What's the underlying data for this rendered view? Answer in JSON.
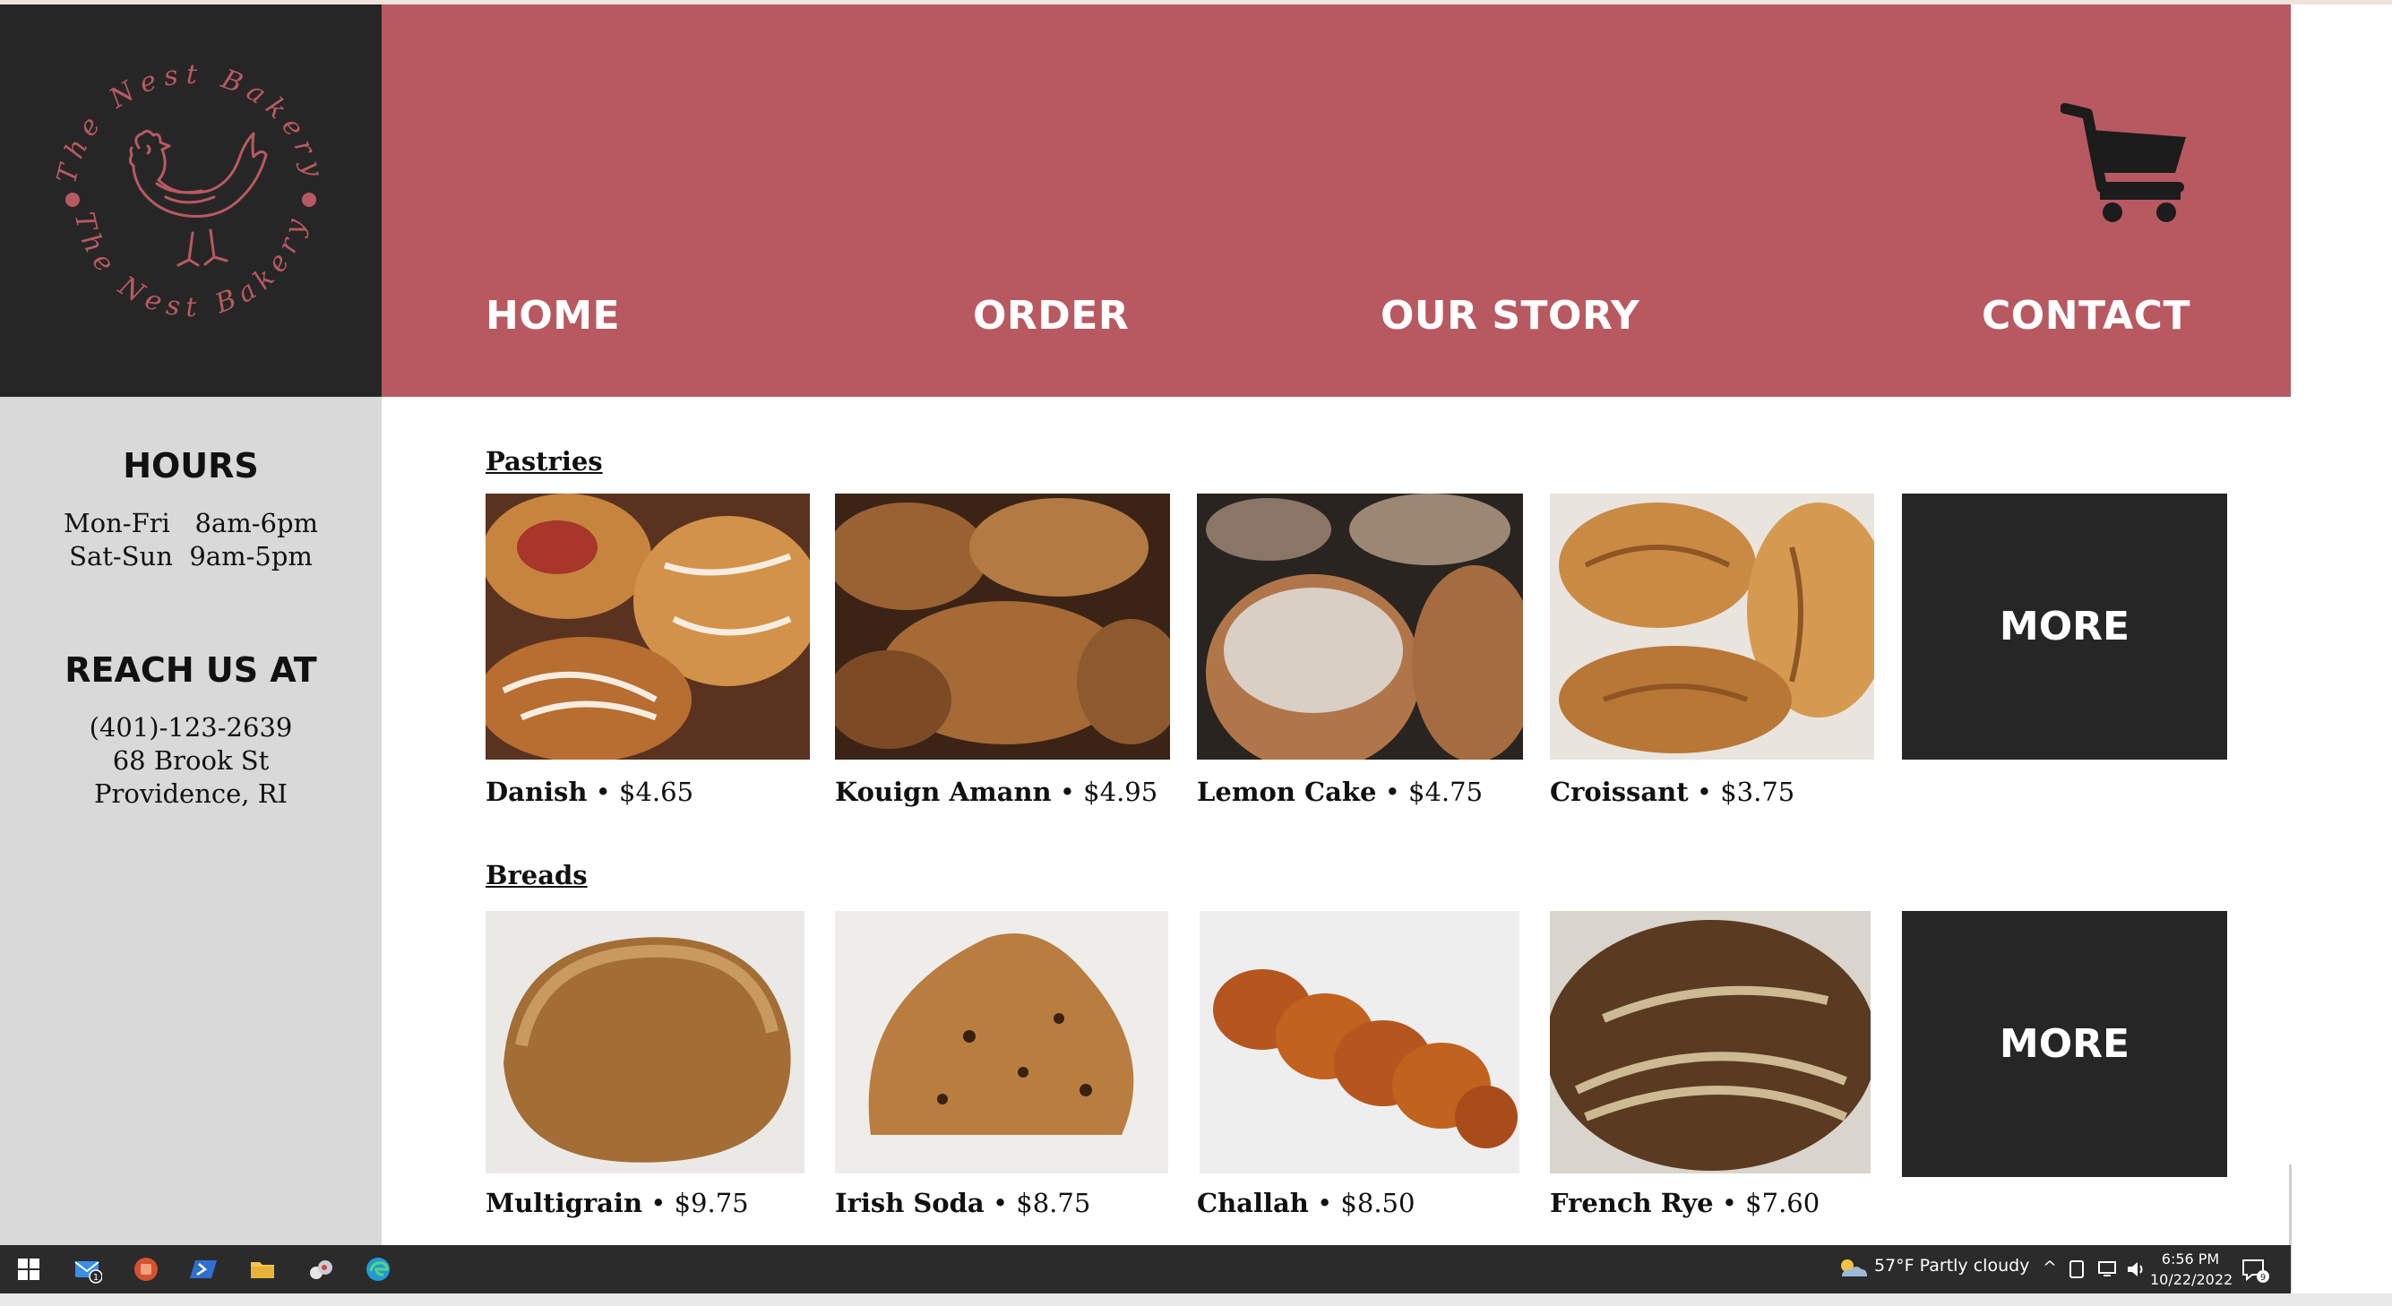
{
  "logo": {
    "text_top": "The Nest Bakery",
    "text_bottom": "The Nest Bakery",
    "icon": "hen-icon",
    "color": "#b85962"
  },
  "nav": {
    "home": "HOME",
    "order": "ORDER",
    "story": "OUR STORY",
    "contact": "CONTACT",
    "cart_icon": "shopping-cart-icon"
  },
  "sidebar": {
    "hours_heading": "HOURS",
    "hours_line1": "Mon-Fri   8am-6pm",
    "hours_line2": "Sat-Sun  9am-5pm",
    "reach_heading": "REACH US AT",
    "phone": "(401)-123-2639",
    "street": "68 Brook St",
    "city": "Providence, RI"
  },
  "sections": {
    "pastries": {
      "title": "Pastries",
      "more_label": "MORE",
      "items": [
        {
          "name": "Danish",
          "price": "• $4.65"
        },
        {
          "name": "Kouign Amann",
          "price": "• $4.95"
        },
        {
          "name": "Lemon Cake",
          "price": "• $4.75"
        },
        {
          "name": "Croissant",
          "price": "• $3.75"
        }
      ]
    },
    "breads": {
      "title": "Breads",
      "more_label": "MORE",
      "items": [
        {
          "name": "Multigrain",
          "price": "• $9.75"
        },
        {
          "name": "Irish Soda",
          "price": "• $8.75"
        },
        {
          "name": "Challah",
          "price": "• $8.50"
        },
        {
          "name": "French Rye",
          "price": "• $7.60"
        }
      ]
    }
  },
  "taskbar": {
    "weather": "57°F  Partly cloudy",
    "time": "6:56 PM",
    "date": "10/22/2022",
    "mail_badge": "1",
    "notification_badge": "9"
  },
  "colors": {
    "header": "#b85962",
    "dark": "#262626",
    "sidebar": "#d9d9d9"
  }
}
